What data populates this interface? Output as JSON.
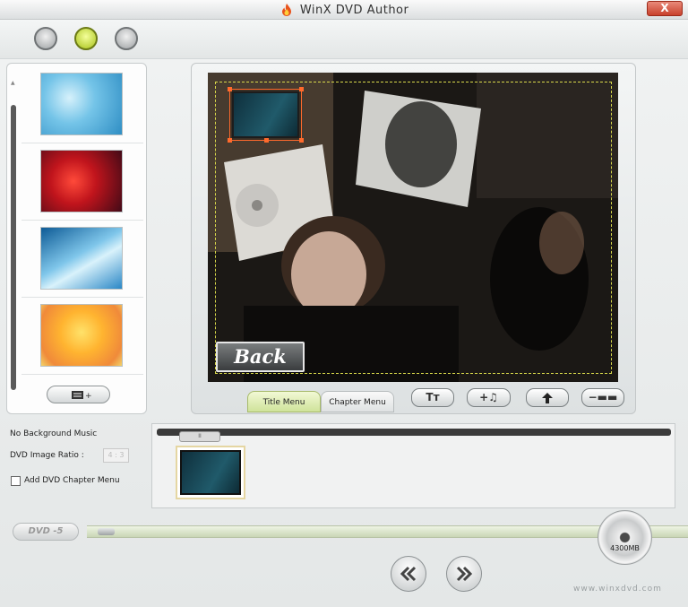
{
  "window": {
    "title": "WinX DVD Author",
    "close_label": "X"
  },
  "steps": [
    {
      "state": "inactive"
    },
    {
      "state": "active"
    },
    {
      "state": "inactive"
    }
  ],
  "backgrounds": [
    {
      "name": "blue-ice"
    },
    {
      "name": "red-roses"
    },
    {
      "name": "blue-light"
    },
    {
      "name": "yellow-flowers"
    }
  ],
  "preview": {
    "back_button_label": "Back"
  },
  "menu_tabs": [
    {
      "label": "Title Menu",
      "selected": true
    },
    {
      "label": "Chapter Menu",
      "selected": false
    }
  ],
  "tools": {
    "text_label": "Tт",
    "music_label": "+♫",
    "up_icon": "up-arrow-icon",
    "remove_label": "−▬▬"
  },
  "settings": {
    "music_status": "No Background Music",
    "ratio_label": "DVD Image Ratio :",
    "ratio_value": "4 : 3",
    "chapter_menu_label": "Add DVD Chapter Menu"
  },
  "timeline": {
    "scroll_thumb_label": "II"
  },
  "disc": {
    "badge": "DVD -5",
    "capacity": "4300MB",
    "used_fraction": 0.03
  },
  "footer": {
    "site": "www.winxdvd.com"
  },
  "colors": {
    "accent_green": "#b9d23a",
    "close_red": "#c8412c",
    "selection_orange": "#ff6a2c"
  }
}
